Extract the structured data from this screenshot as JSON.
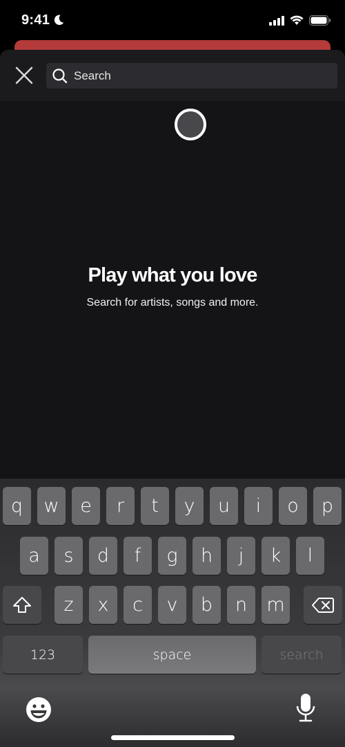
{
  "status_bar": {
    "time": "9:41",
    "focus_icon": "moon-icon",
    "signal_icon": "cellular-signal-icon",
    "wifi_icon": "wifi-icon",
    "battery_icon": "battery-icon"
  },
  "header": {
    "close_icon": "close-icon",
    "search_icon": "search-icon",
    "search_placeholder": "Search",
    "search_value": ""
  },
  "loading_indicator": "spinner",
  "empty_state": {
    "title": "Play what you love",
    "subtitle": "Search for artists, songs and more."
  },
  "colors": {
    "background": "#141316",
    "header": "#1b1a1d",
    "search_field": "#2c2b2f",
    "banner_red": "#b53a3a"
  },
  "keyboard": {
    "row1": [
      "q",
      "w",
      "e",
      "r",
      "t",
      "y",
      "u",
      "i",
      "o",
      "p"
    ],
    "row2": [
      "a",
      "s",
      "d",
      "f",
      "g",
      "h",
      "j",
      "k",
      "l"
    ],
    "row3": [
      "z",
      "x",
      "c",
      "v",
      "b",
      "n",
      "m"
    ],
    "shift_icon": "shift-icon",
    "backspace_icon": "backspace-icon",
    "numbers_label": "123",
    "space_label": "space",
    "return_label": "search",
    "emoji_icon": "emoji-icon",
    "mic_icon": "microphone-icon"
  }
}
